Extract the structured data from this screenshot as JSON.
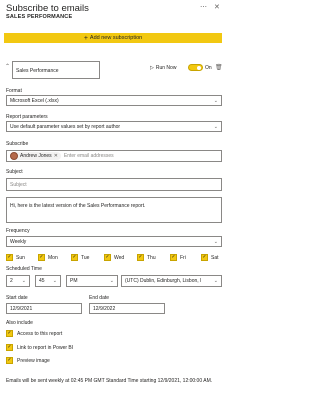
{
  "header": {
    "title": "Subscribe to emails",
    "subtitle": "SALES PERFORMANCE",
    "more_icon": "ellipsis-icon",
    "close_icon": "close-icon"
  },
  "add_button_label": "Add new subscription",
  "subscription": {
    "name": "Sales Performance",
    "run_now_label": "Run Now",
    "toggle_label": "On",
    "toggle_on": true
  },
  "format": {
    "label": "Format",
    "value": "Microsoft Excel (.xlsx)"
  },
  "report_parameters": {
    "label": "Report parameters",
    "value": "Use default parameter values set by report author"
  },
  "subscribe": {
    "label": "Subscribe",
    "recipients": [
      "Andrew Jones"
    ],
    "placeholder": "Enter email addresses"
  },
  "subject": {
    "label": "Subject",
    "placeholder": "Subject"
  },
  "message": {
    "value": "Hi, here is the latest version of the Sales Performance report."
  },
  "frequency": {
    "label": "Frequency",
    "value": "Weekly"
  },
  "days": [
    {
      "label": "Sun",
      "checked": true
    },
    {
      "label": "Mon",
      "checked": true
    },
    {
      "label": "Tue",
      "checked": true
    },
    {
      "label": "Wed",
      "checked": true
    },
    {
      "label": "Thu",
      "checked": true
    },
    {
      "label": "Fri",
      "checked": true
    },
    {
      "label": "Sat",
      "checked": true
    }
  ],
  "scheduled_time": {
    "label": "Scheduled Time",
    "hour": "2",
    "minute": "45",
    "ampm": "PM",
    "timezone": "(UTC) Dublin, Edinburgh, Lisbon, l"
  },
  "start_date": {
    "label": "Start date",
    "value": "12/9/2021"
  },
  "end_date": {
    "label": "End date",
    "value": "12/9/2022"
  },
  "also_include": {
    "label": "Also include",
    "options": [
      {
        "label": "Access to this report",
        "checked": true
      },
      {
        "label": "Link to report in Power BI",
        "checked": true
      },
      {
        "label": "Preview image",
        "checked": true
      }
    ]
  },
  "footer_text": "Emails will be sent weekly at 02:45 PM GMT Standard Time starting 12/9/2021, 12:00:00 AM.",
  "colors": {
    "accent": "#f2c811",
    "border": "#8a8886",
    "text": "#252423"
  }
}
